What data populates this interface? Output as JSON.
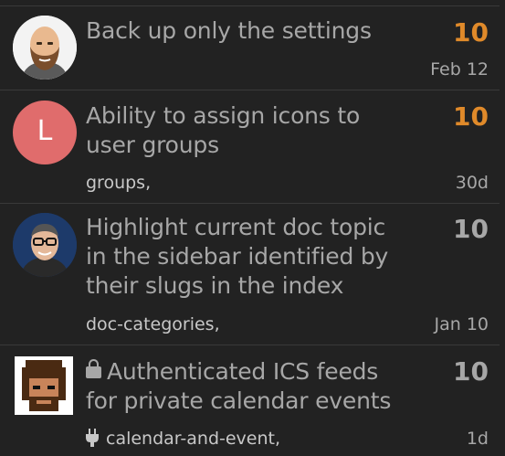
{
  "topics": [
    {
      "title": "Back up only the settings",
      "reply_count": "10",
      "last_activity": "Feb 12",
      "tags": "",
      "avatar": "bearded-bald-man-avatar"
    },
    {
      "title": "Ability to assign icons to user groups",
      "reply_count": "10",
      "last_activity": "30d",
      "tags": "groups,",
      "avatar_letter": "L",
      "avatar_color": "#e06c6c"
    },
    {
      "title": "Highlight current doc topic in the sidebar identified by their slugs in the index",
      "reply_count": "10",
      "last_activity": "Jan 10",
      "tags": "doc-categories,",
      "avatar": "man-with-glasses-avatar"
    },
    {
      "title": "Authenticated ICS feeds for private calendar events",
      "reply_count": "10",
      "last_activity": "1d",
      "tags": "calendar-and-event,",
      "avatar": "pixel-art-curly-hair-avatar",
      "title_icon": "lock-icon",
      "tag_icon": "plug-icon"
    }
  ],
  "colors": {
    "background": "#222222",
    "hot_count": "#e08a2a",
    "normal_count": "#a7a7a7",
    "title": "#a7a7a7",
    "divider": "#3a3a3a"
  }
}
